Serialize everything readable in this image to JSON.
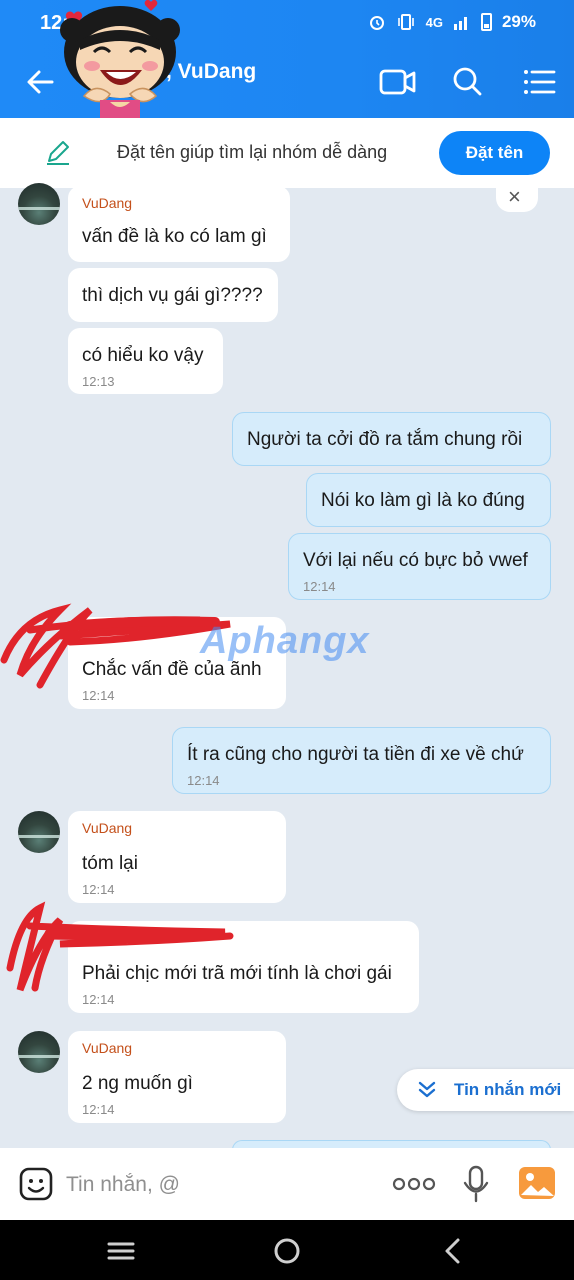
{
  "status": {
    "time": "12:",
    "network": "4G",
    "battery": "29%"
  },
  "header": {
    "title": ", VuDang"
  },
  "banner": {
    "text": "Đặt tên giúp tìm lại nhóm dễ dàng",
    "button": "Đặt tên"
  },
  "messages": [
    {
      "sender": "VuDang",
      "text": "vấn đề là ko có lam gì"
    },
    {
      "text": "thì dịch vụ gái gì????"
    },
    {
      "text": "có hiểu ko vậy",
      "time": "12:13"
    },
    {
      "text": "Người ta cởi đồ ra tắm chung rồi"
    },
    {
      "text": "Nói ko làm gì là ko đúng"
    },
    {
      "text": "Với lại nếu có bực bỏ vwef",
      "time": "12:14"
    },
    {
      "text": "Chắc vấn đề của ãnh",
      "time": "12:14"
    },
    {
      "text": "Ít ra cũng cho người ta tiền đi xe về chứ",
      "time": "12:14"
    },
    {
      "sender": "VuDang",
      "text": "tóm lại",
      "time": "12:14"
    },
    {
      "text": "Phải chịc mới trã mới tính là chơi gái",
      "time": "12:14"
    },
    {
      "sender": "VuDang",
      "text": "2 ng muốn gì",
      "time": "12:14"
    }
  ],
  "watermark": "Aphangx",
  "new_message_label": "Tin nhắn mới",
  "composer": {
    "placeholder": "Tin nhắn, @"
  },
  "colors": {
    "header": "#1d86f2",
    "accent": "#0d84f7",
    "sender_name": "#c4501b",
    "outgoing_bubble": "#d6ecfb"
  }
}
